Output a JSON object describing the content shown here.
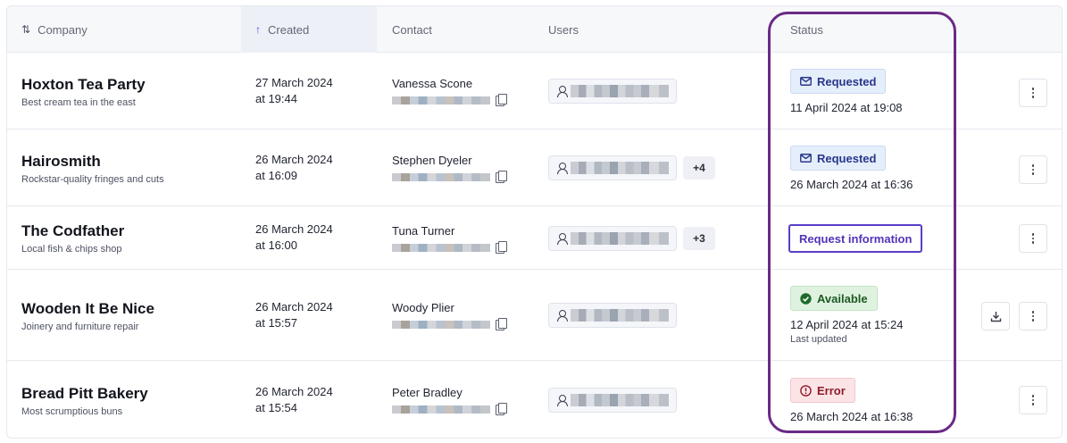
{
  "columns": {
    "company": "Company",
    "created": "Created",
    "contact": "Contact",
    "users": "Users",
    "status": "Status"
  },
  "colors": {
    "highlight": "#6a2a86",
    "accent": "#5034b8",
    "requested_bg": "#e5eefb",
    "available_bg": "#dff2df",
    "error_bg": "#fce4e6"
  },
  "rows": [
    {
      "company": "Hoxton Tea Party",
      "description": "Best cream tea in the east",
      "created_date": "27 March 2024",
      "created_time": "at 19:44",
      "contact": "Vanessa Scone",
      "extra_users": "",
      "status_label": "Requested",
      "status_icon": "envelope-icon",
      "status_date": "11 April 2024 at 19:08"
    },
    {
      "company": "Hairosmith",
      "description": "Rockstar-quality fringes and cuts",
      "created_date": "26 March 2024",
      "created_time": "at 16:09",
      "contact": "Stephen Dyeler",
      "extra_users": "+4",
      "status_label": "Requested",
      "status_icon": "envelope-icon",
      "status_date": "26 March 2024 at 16:36"
    },
    {
      "company": "The Codfather",
      "description": "Local fish & chips shop",
      "created_date": "26 March 2024",
      "created_time": "at 16:00",
      "contact": "Tuna Turner",
      "extra_users": "+3",
      "action_label": "Request information"
    },
    {
      "company": "Wooden It Be Nice",
      "description": "Joinery and furniture repair",
      "created_date": "26 March 2024",
      "created_time": "at 15:57",
      "contact": "Woody Plier",
      "extra_users": "",
      "status_label": "Available",
      "status_icon": "check-circle-icon",
      "status_date": "12 April 2024 at 15:24",
      "status_sub": "Last updated"
    },
    {
      "company": "Bread Pitt Bakery",
      "description": "Most scrumptious buns",
      "created_date": "26 March 2024",
      "created_time": "at 15:54",
      "contact": "Peter Bradley",
      "extra_users": "",
      "status_label": "Error",
      "status_icon": "alert-circle-icon",
      "status_date": "26 March 2024 at 16:38"
    }
  ]
}
